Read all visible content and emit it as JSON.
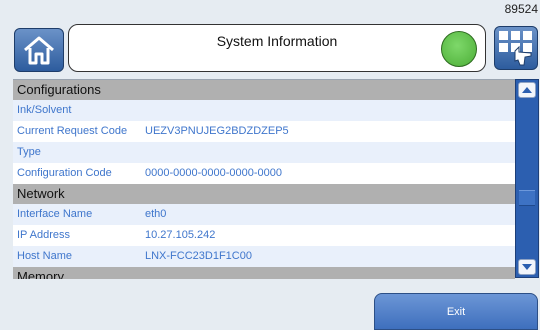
{
  "header": {
    "device_id": "89524",
    "title": "System Information",
    "home_icon": "home-icon",
    "menu_icon": "grid-hand-icon",
    "status_color": "#5cc24a"
  },
  "sections": {
    "configurations": {
      "title": "Configurations",
      "rows": [
        {
          "label": "Ink/Solvent",
          "value": ""
        },
        {
          "label": "Current Request Code",
          "value": "UEZV3PNUJEG2BDZDZEP5"
        },
        {
          "label": "Type",
          "value": ""
        },
        {
          "label": "Configuration Code",
          "value": "0000-0000-0000-0000-0000"
        }
      ]
    },
    "network": {
      "title": "Network",
      "rows": [
        {
          "label": "Interface Name",
          "value": "eth0"
        },
        {
          "label": "IP Address",
          "value": "10.27.105.242"
        },
        {
          "label": "Host Name",
          "value": "LNX-FCC23D1F1C00"
        }
      ]
    },
    "memory": {
      "title": "Memory"
    }
  },
  "footer": {
    "exit_label": "Exit"
  },
  "colors": {
    "accent": "#2c5fb0",
    "row_text": "#3f76cc",
    "section_header": "#b0b0b0"
  }
}
